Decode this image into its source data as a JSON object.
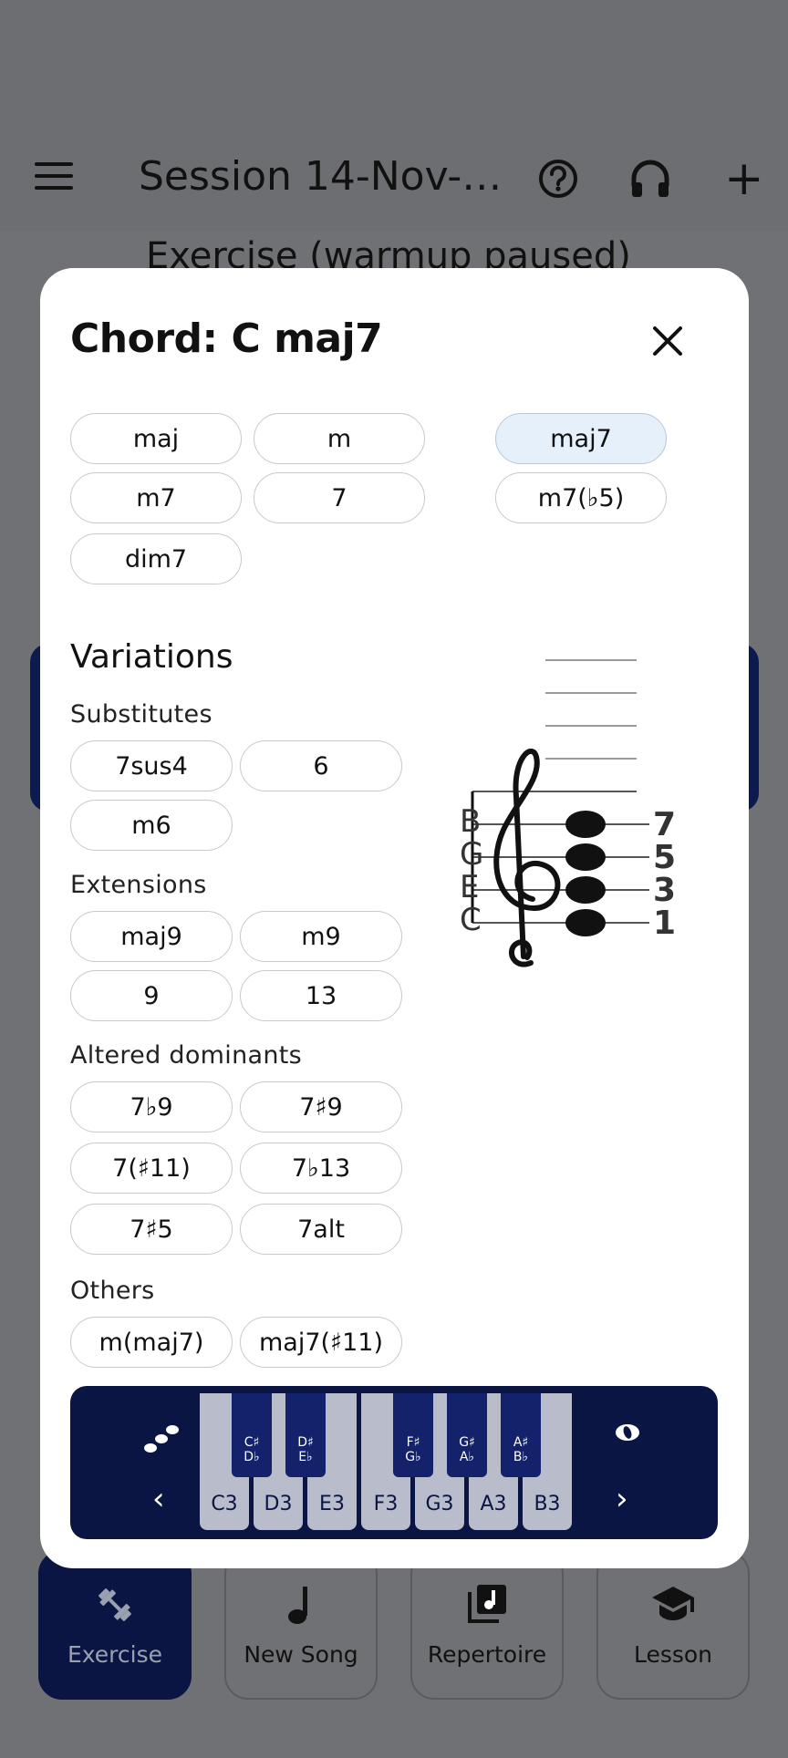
{
  "appbar": {
    "title": "Session 14-Nov-…",
    "background_heading": "Exercise (warmup paused)"
  },
  "dialog": {
    "title": "Chord: C maj7",
    "qualities": [
      {
        "label": "maj",
        "selected": false
      },
      {
        "label": "m",
        "selected": false
      },
      {
        "label": "maj7",
        "selected": true
      },
      {
        "label": "m7",
        "selected": false
      },
      {
        "label": "7",
        "selected": false
      },
      {
        "label": "m7(♭5)",
        "selected": false
      },
      {
        "label": "dim7",
        "selected": false
      }
    ],
    "variations": {
      "heading": "Variations",
      "substitutes": {
        "heading": "Substitutes",
        "items": [
          "7sus4",
          "6",
          "m6"
        ]
      },
      "extensions": {
        "heading": "Extensions",
        "items": [
          "maj9",
          "m9",
          "9",
          "13"
        ]
      },
      "altered": {
        "heading": "Altered dominants",
        "items": [
          "7♭9",
          "7♯9",
          "7(♯11)",
          "7♭13",
          "7♯5",
          "7alt"
        ]
      },
      "others": {
        "heading": "Others",
        "items": [
          "m(maj7)",
          "maj7(♯11)"
        ]
      }
    },
    "staff": {
      "notes": [
        "B",
        "G",
        "E",
        "C"
      ],
      "degrees": [
        "7",
        "5",
        "3",
        "1"
      ]
    },
    "keyboard": {
      "white_keys": [
        "C3",
        "D3",
        "E3",
        "F3",
        "G3",
        "A3",
        "B3"
      ],
      "black_keys": [
        {
          "sharp": "C♯",
          "flat": "D♭"
        },
        {
          "sharp": "D♯",
          "flat": "E♭"
        },
        {
          "sharp": "F♯",
          "flat": "G♭"
        },
        {
          "sharp": "G♯",
          "flat": "A♭"
        },
        {
          "sharp": "A♯",
          "flat": "B♭"
        }
      ],
      "prev": "‹",
      "next": "›"
    }
  },
  "bottom_nav": [
    {
      "label": "Exercise",
      "icon": "dumbbell-icon",
      "active": true
    },
    {
      "label": "New Song",
      "icon": "music-note-icon",
      "active": false
    },
    {
      "label": "Repertoire",
      "icon": "library-music-icon",
      "active": false
    },
    {
      "label": "Lesson",
      "icon": "school-icon",
      "active": false
    }
  ],
  "colors": {
    "keyboard_bg": "#0a1544",
    "selected_chip": "#e6f0fb",
    "scrim": "#707174"
  }
}
